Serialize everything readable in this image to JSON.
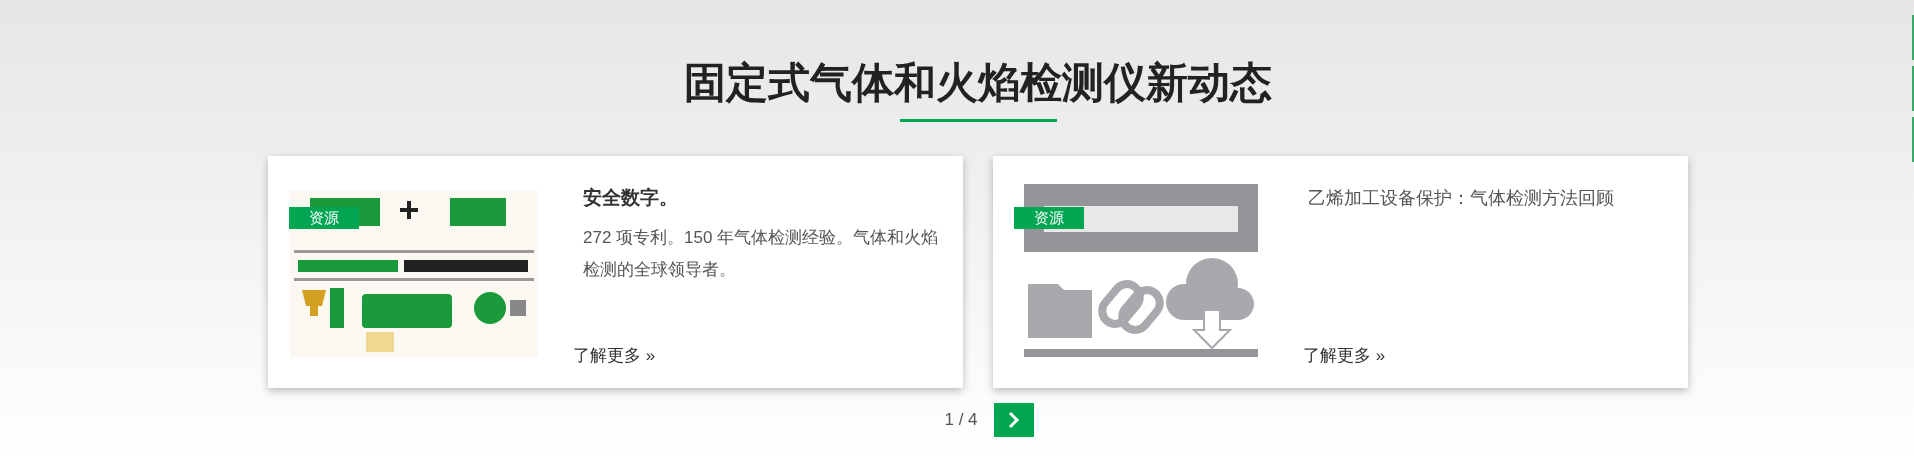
{
  "heading": "固定式气体和火焰检测仪新动态",
  "cards": [
    {
      "tag": "资源",
      "title": "安全数字。",
      "title_bold": true,
      "description": "272 项专利。150 年气体检测经验。气体和火焰检测的全球领导者。",
      "link": "了解更多 »"
    },
    {
      "tag": "资源",
      "title": "乙烯加工设备保护：气体检测方法回顾",
      "title_bold": false,
      "link": "了解更多 »"
    }
  ],
  "pager": {
    "label": "1 / 4"
  },
  "side_nav": [
    {
      "selected": false
    },
    {
      "selected": false
    },
    {
      "selected": false
    }
  ]
}
